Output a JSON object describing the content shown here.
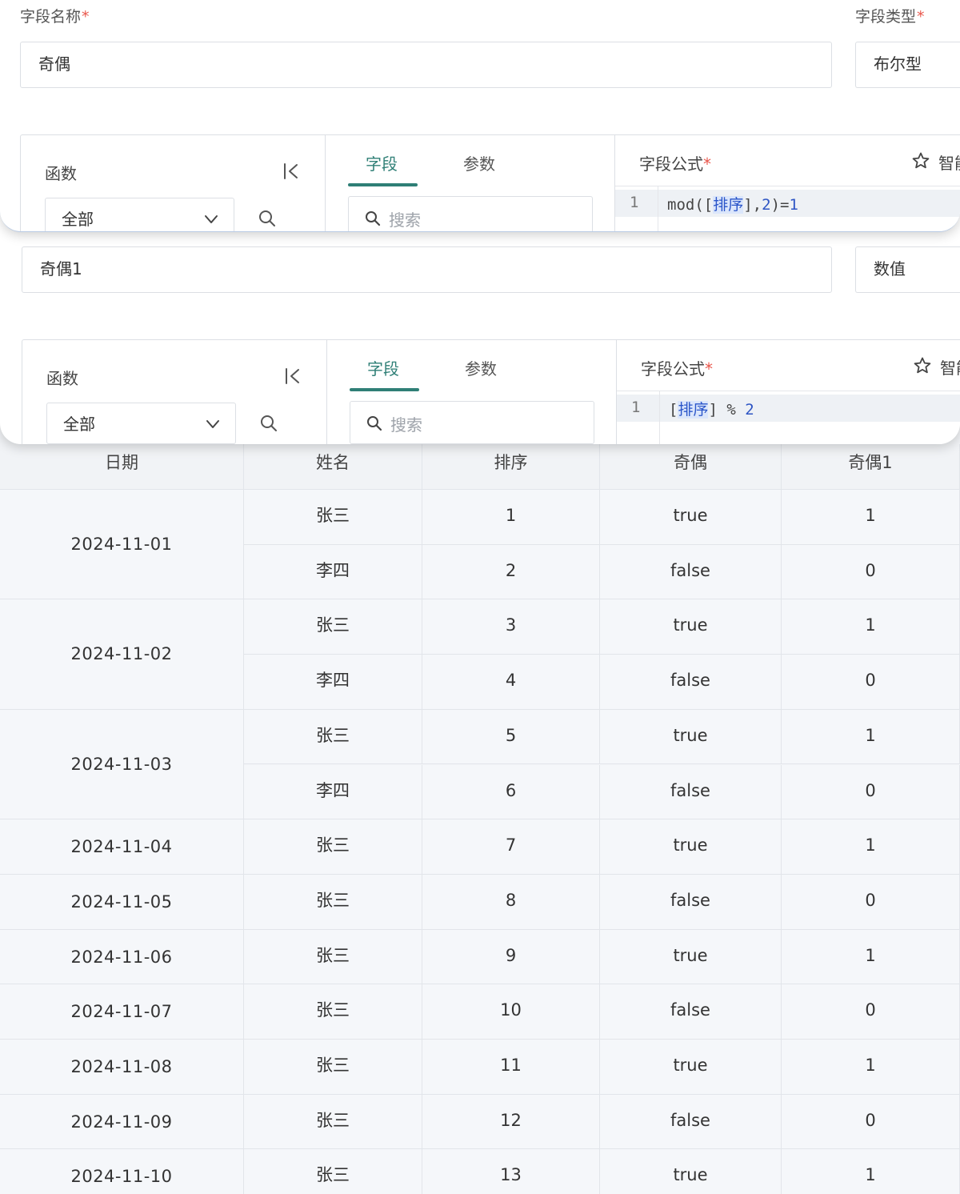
{
  "dialog1": {
    "name_label": "字段名称",
    "type_label": "字段类型",
    "required_mark": "*",
    "name_value": "奇偶",
    "type_value": "布尔型",
    "functions_title": "函数",
    "function_category": "全部",
    "tab_fields": "字段",
    "tab_params": "参数",
    "search_placeholder": "搜索",
    "formula_label": "字段公式",
    "smart_label": "智能",
    "line_number": "1",
    "formula": {
      "pre": "mod([",
      "field": "排序",
      "mid": "],",
      "n1": "2",
      "post": ")=",
      "n2": "1"
    }
  },
  "dialog2": {
    "name_value": "奇偶1",
    "type_value": "数值",
    "functions_title": "函数",
    "function_category": "全部",
    "tab_fields": "字段",
    "tab_params": "参数",
    "search_placeholder": "搜索",
    "formula_label": "字段公式",
    "required_mark": "*",
    "smart_label": "智能",
    "line_number": "1",
    "formula": {
      "pre": "[",
      "field": "排序",
      "post": "] % ",
      "n": "2"
    }
  },
  "table": {
    "columns": [
      "日期",
      "姓名",
      "排序",
      "奇偶",
      "奇偶1"
    ],
    "groups": [
      {
        "date": "2024-11-01",
        "rows": [
          [
            "张三",
            "1",
            "true",
            "1"
          ],
          [
            "李四",
            "2",
            "false",
            "0"
          ]
        ]
      },
      {
        "date": "2024-11-02",
        "rows": [
          [
            "张三",
            "3",
            "true",
            "1"
          ],
          [
            "李四",
            "4",
            "false",
            "0"
          ]
        ]
      },
      {
        "date": "2024-11-03",
        "rows": [
          [
            "张三",
            "5",
            "true",
            "1"
          ],
          [
            "李四",
            "6",
            "false",
            "0"
          ]
        ]
      },
      {
        "date": "2024-11-04",
        "rows": [
          [
            "张三",
            "7",
            "true",
            "1"
          ]
        ]
      },
      {
        "date": "2024-11-05",
        "rows": [
          [
            "张三",
            "8",
            "false",
            "0"
          ]
        ]
      },
      {
        "date": "2024-11-06",
        "rows": [
          [
            "张三",
            "9",
            "true",
            "1"
          ]
        ]
      },
      {
        "date": "2024-11-07",
        "rows": [
          [
            "张三",
            "10",
            "false",
            "0"
          ]
        ]
      },
      {
        "date": "2024-11-08",
        "rows": [
          [
            "张三",
            "11",
            "true",
            "1"
          ]
        ]
      },
      {
        "date": "2024-11-09",
        "rows": [
          [
            "张三",
            "12",
            "false",
            "0"
          ]
        ]
      },
      {
        "date": "2024-11-10",
        "rows": [
          [
            "张三",
            "13",
            "true",
            "1"
          ]
        ]
      }
    ]
  }
}
